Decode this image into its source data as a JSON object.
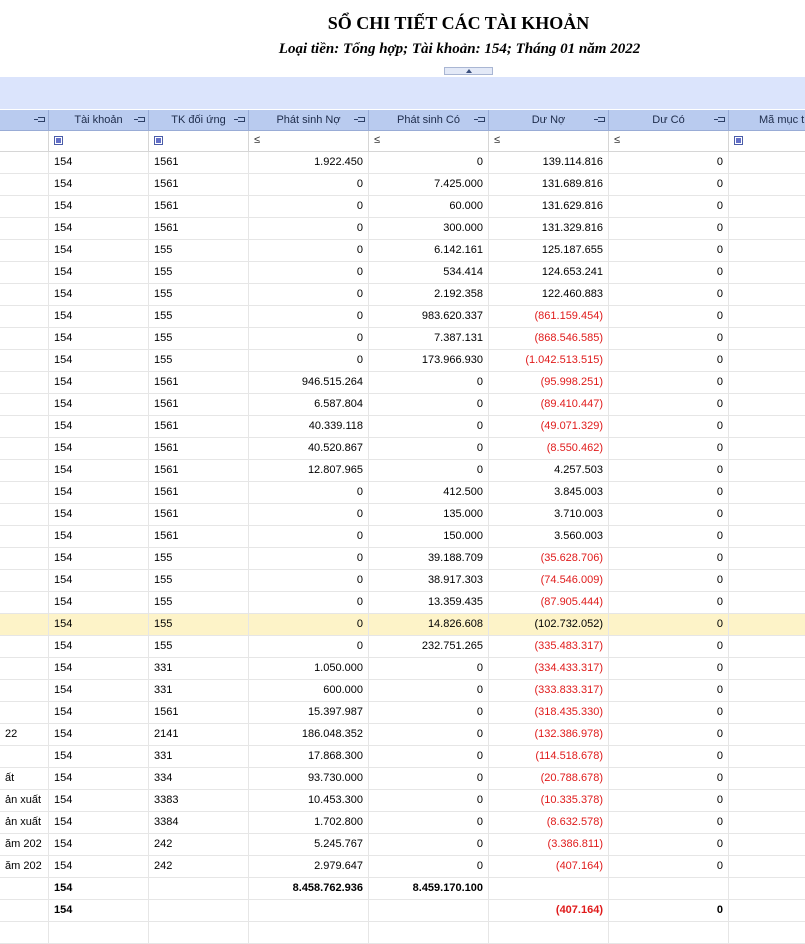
{
  "report": {
    "title": "SỔ CHI TIẾT CÁC TÀI KHOẢN",
    "subtitle": "Loại tiền: Tổng hợp; Tài khoản: 154; Tháng 01 năm 2022"
  },
  "columns": {
    "tai_khoan": "Tài khoản",
    "tk_doi_ung": "TK đối ứng",
    "phat_sinh_no": "Phát sinh Nợ",
    "phat_sinh_co": "Phát sinh Có",
    "du_no": "Dư Nợ",
    "du_co": "Dư Có",
    "ma_muc": "Mã mục t"
  },
  "filter_symbol": "≤",
  "rows": [
    {
      "desc": "",
      "tk": "154",
      "du": "1561",
      "no": "1.922.450",
      "co": "0",
      "duno": "139.114.816",
      "neg": false,
      "duco": "0"
    },
    {
      "desc": "",
      "tk": "154",
      "du": "1561",
      "no": "0",
      "co": "7.425.000",
      "duno": "131.689.816",
      "neg": false,
      "duco": "0"
    },
    {
      "desc": "",
      "tk": "154",
      "du": "1561",
      "no": "0",
      "co": "60.000",
      "duno": "131.629.816",
      "neg": false,
      "duco": "0"
    },
    {
      "desc": "",
      "tk": "154",
      "du": "1561",
      "no": "0",
      "co": "300.000",
      "duno": "131.329.816",
      "neg": false,
      "duco": "0"
    },
    {
      "desc": "",
      "tk": "154",
      "du": "155",
      "no": "0",
      "co": "6.142.161",
      "duno": "125.187.655",
      "neg": false,
      "duco": "0"
    },
    {
      "desc": "",
      "tk": "154",
      "du": "155",
      "no": "0",
      "co": "534.414",
      "duno": "124.653.241",
      "neg": false,
      "duco": "0"
    },
    {
      "desc": "",
      "tk": "154",
      "du": "155",
      "no": "0",
      "co": "2.192.358",
      "duno": "122.460.883",
      "neg": false,
      "duco": "0"
    },
    {
      "desc": "",
      "tk": "154",
      "du": "155",
      "no": "0",
      "co": "983.620.337",
      "duno": "(861.159.454)",
      "neg": true,
      "duco": "0"
    },
    {
      "desc": "",
      "tk": "154",
      "du": "155",
      "no": "0",
      "co": "7.387.131",
      "duno": "(868.546.585)",
      "neg": true,
      "duco": "0"
    },
    {
      "desc": "",
      "tk": "154",
      "du": "155",
      "no": "0",
      "co": "173.966.930",
      "duno": "(1.042.513.515)",
      "neg": true,
      "duco": "0"
    },
    {
      "desc": "",
      "tk": "154",
      "du": "1561",
      "no": "946.515.264",
      "co": "0",
      "duno": "(95.998.251)",
      "neg": true,
      "duco": "0"
    },
    {
      "desc": "",
      "tk": "154",
      "du": "1561",
      "no": "6.587.804",
      "co": "0",
      "duno": "(89.410.447)",
      "neg": true,
      "duco": "0"
    },
    {
      "desc": "",
      "tk": "154",
      "du": "1561",
      "no": "40.339.118",
      "co": "0",
      "duno": "(49.071.329)",
      "neg": true,
      "duco": "0"
    },
    {
      "desc": "",
      "tk": "154",
      "du": "1561",
      "no": "40.520.867",
      "co": "0",
      "duno": "(8.550.462)",
      "neg": true,
      "duco": "0"
    },
    {
      "desc": "",
      "tk": "154",
      "du": "1561",
      "no": "12.807.965",
      "co": "0",
      "duno": "4.257.503",
      "neg": false,
      "duco": "0"
    },
    {
      "desc": "",
      "tk": "154",
      "du": "1561",
      "no": "0",
      "co": "412.500",
      "duno": "3.845.003",
      "neg": false,
      "duco": "0"
    },
    {
      "desc": "",
      "tk": "154",
      "du": "1561",
      "no": "0",
      "co": "135.000",
      "duno": "3.710.003",
      "neg": false,
      "duco": "0"
    },
    {
      "desc": "",
      "tk": "154",
      "du": "1561",
      "no": "0",
      "co": "150.000",
      "duno": "3.560.003",
      "neg": false,
      "duco": "0"
    },
    {
      "desc": "",
      "tk": "154",
      "du": "155",
      "no": "0",
      "co": "39.188.709",
      "duno": "(35.628.706)",
      "neg": true,
      "duco": "0"
    },
    {
      "desc": "",
      "tk": "154",
      "du": "155",
      "no": "0",
      "co": "38.917.303",
      "duno": "(74.546.009)",
      "neg": true,
      "duco": "0"
    },
    {
      "desc": "",
      "tk": "154",
      "du": "155",
      "no": "0",
      "co": "13.359.435",
      "duno": "(87.905.444)",
      "neg": true,
      "duco": "0"
    },
    {
      "desc": "",
      "tk": "154",
      "du": "155",
      "no": "0",
      "co": "14.826.608",
      "duno": "(102.732.052)",
      "neg": false,
      "duco": "0",
      "hl": true
    },
    {
      "desc": "",
      "tk": "154",
      "du": "155",
      "no": "0",
      "co": "232.751.265",
      "duno": "(335.483.317)",
      "neg": true,
      "duco": "0"
    },
    {
      "desc": "",
      "tk": "154",
      "du": "331",
      "no": "1.050.000",
      "co": "0",
      "duno": "(334.433.317)",
      "neg": true,
      "duco": "0"
    },
    {
      "desc": "",
      "tk": "154",
      "du": "331",
      "no": "600.000",
      "co": "0",
      "duno": "(333.833.317)",
      "neg": true,
      "duco": "0"
    },
    {
      "desc": "",
      "tk": "154",
      "du": "1561",
      "no": "15.397.987",
      "co": "0",
      "duno": "(318.435.330)",
      "neg": true,
      "duco": "0"
    },
    {
      "desc": "22",
      "tk": "154",
      "du": "2141",
      "no": "186.048.352",
      "co": "0",
      "duno": "(132.386.978)",
      "neg": true,
      "duco": "0"
    },
    {
      "desc": "",
      "tk": "154",
      "du": "331",
      "no": "17.868.300",
      "co": "0",
      "duno": "(114.518.678)",
      "neg": true,
      "duco": "0"
    },
    {
      "desc": "ất",
      "tk": "154",
      "du": "334",
      "no": "93.730.000",
      "co": "0",
      "duno": "(20.788.678)",
      "neg": true,
      "duco": "0"
    },
    {
      "desc": "ản xuất",
      "tk": "154",
      "du": "3383",
      "no": "10.453.300",
      "co": "0",
      "duno": "(10.335.378)",
      "neg": true,
      "duco": "0"
    },
    {
      "desc": "ản xuất",
      "tk": "154",
      "du": "3384",
      "no": "1.702.800",
      "co": "0",
      "duno": "(8.632.578)",
      "neg": true,
      "duco": "0"
    },
    {
      "desc": "ăm 202",
      "tk": "154",
      "du": "242",
      "no": "5.245.767",
      "co": "0",
      "duno": "(3.386.811)",
      "neg": true,
      "duco": "0"
    },
    {
      "desc": "ăm 202",
      "tk": "154",
      "du": "242",
      "no": "2.979.647",
      "co": "0",
      "duno": "(407.164)",
      "neg": true,
      "duco": "0"
    }
  ],
  "total_row": {
    "tk": "154",
    "no": "8.458.762.936",
    "co": "8.459.170.100"
  },
  "closing_row": {
    "tk": "154",
    "duno": "(407.164)",
    "duco": "0"
  }
}
